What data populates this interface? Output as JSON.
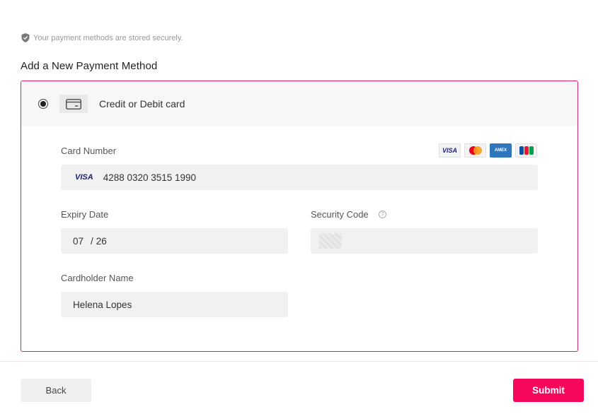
{
  "secure_note": {
    "text": "Your payment methods are stored securely.",
    "icon": "shield-check-icon"
  },
  "section_title": "Add a New Payment Method",
  "method": {
    "label": "Credit or Debit card",
    "selected": true,
    "icon": "credit-card-icon",
    "accent_color": "#d6226a"
  },
  "card_number": {
    "label": "Card Number",
    "brand_tag": "VISA",
    "value": "4288 0320 3515 1990",
    "accepted_brands": [
      "VISA",
      "Mastercard",
      "AMEX",
      "JCB"
    ]
  },
  "expiry": {
    "label": "Expiry Date",
    "month": "07",
    "separator": "/",
    "year": "26"
  },
  "security_code": {
    "label": "Security Code",
    "help_icon": "question-circle-icon"
  },
  "cardholder": {
    "label": "Cardholder Name",
    "value": "Helena Lopes"
  },
  "actions": {
    "back_label": "Back",
    "submit_label": "Submit",
    "submit_color": "#f5085b"
  }
}
